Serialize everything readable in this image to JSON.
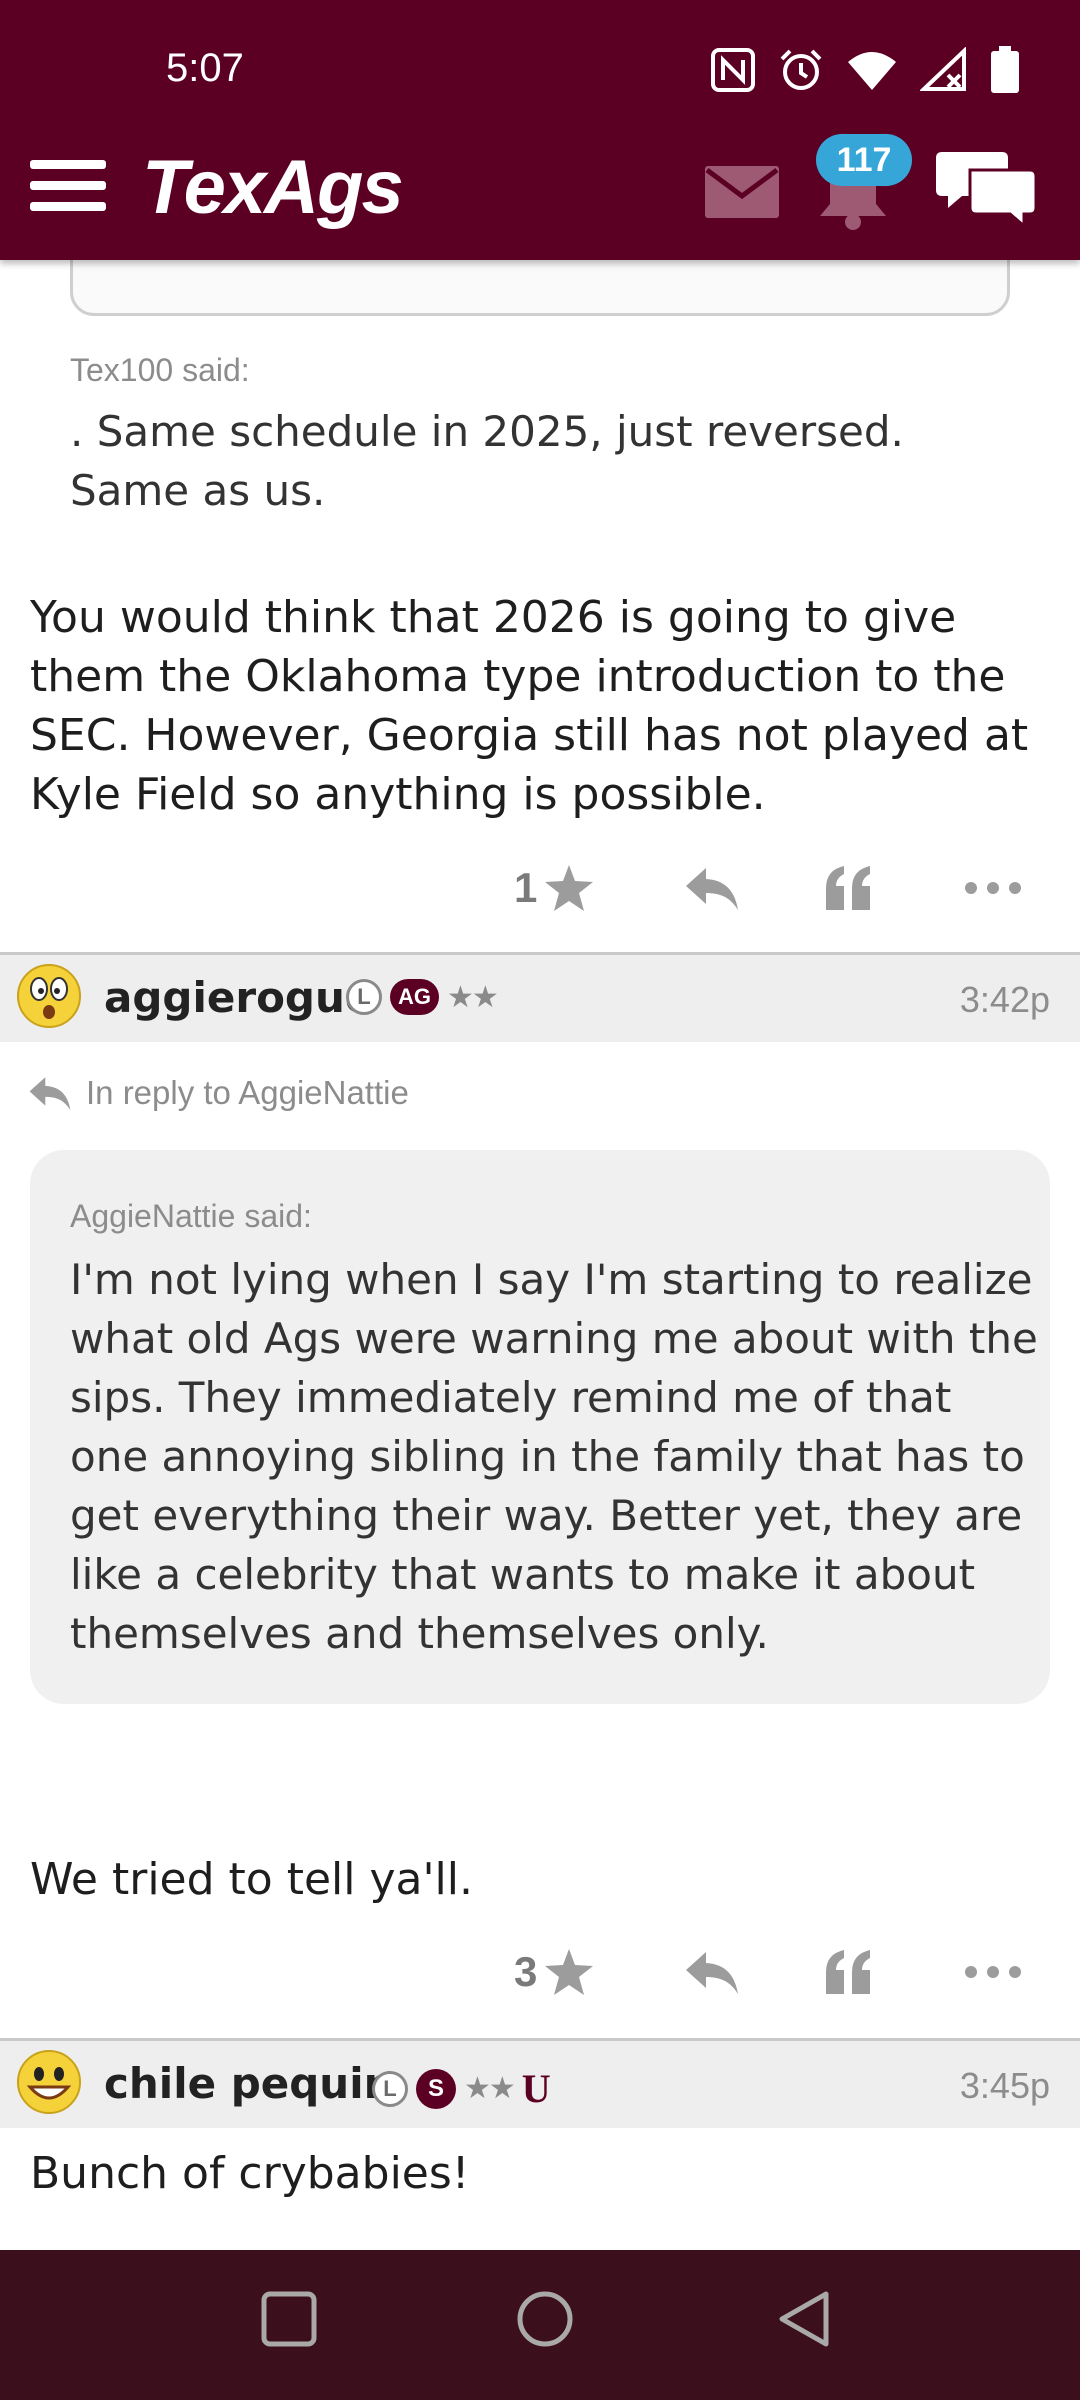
{
  "status_bar": {
    "time": "5:07",
    "icons": [
      "nfc-icon",
      "alarm-icon",
      "wifi-icon",
      "signal-icon",
      "battery-icon"
    ]
  },
  "app_bar": {
    "logo": "TexAgs",
    "notifications_count": "117",
    "icons": [
      "menu-icon",
      "mail-icon",
      "bell-icon",
      "chat-icon"
    ],
    "brand_color": "#5c0023",
    "badge_color": "#36a6d8"
  },
  "posts": [
    {
      "quote": {
        "author": "Tex100 said:",
        "text": ". Same schedule in 2025, just reversed. Same as us."
      },
      "body": "You would think that 2026 is going to give them the Oklahoma type introduction to the SEC. However, Georgia still has not played at Kyle Field so anything is possible.",
      "rating": "1"
    },
    {
      "username": "aggierogue",
      "badges": [
        "L",
        "AG"
      ],
      "time": "3:42p",
      "reply_to": "In reply to AggieNattie",
      "quote": {
        "author": "AggieNattie said:",
        "text": "I'm not lying when I say I'm starting to realize what old Ags were warning me about with the sips. They immediately remind me of that one annoying sibling in the family that has to get everything their way. Better yet, they are like a celebrity that wants to make it about themselves and themselves only."
      },
      "body": "We tried to tell ya'll.",
      "rating": "3"
    },
    {
      "username": "chile pequin",
      "badges": [
        "L",
        "S",
        "U"
      ],
      "time": "3:45p",
      "body": "Bunch of crybabies!"
    }
  ],
  "nav_bar": {
    "icons": [
      "recents-icon",
      "home-icon",
      "back-icon"
    ]
  }
}
